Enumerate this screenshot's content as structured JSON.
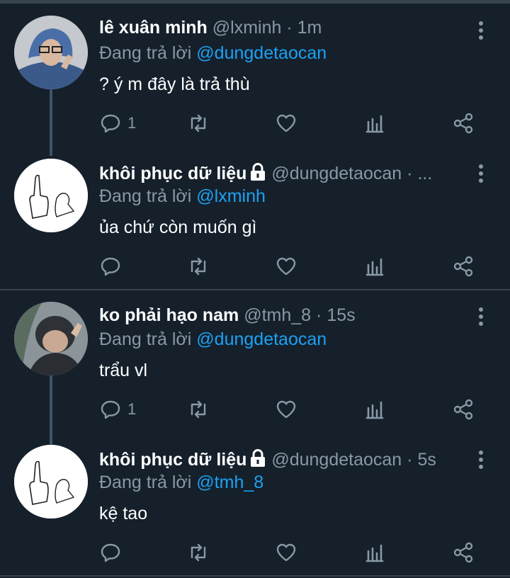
{
  "tweets": [
    {
      "name": "lê xuân minh",
      "locked": false,
      "handle": "@lxminh",
      "time": "· 1m",
      "reply_prefix": "Đang trả lời",
      "reply_to": "@dungdetaocan",
      "text": "? ý m đây là trả thù",
      "reply_count": "1"
    },
    {
      "name": "khôi phục dữ liệu",
      "locked": true,
      "handle": "@dungdetaocan",
      "time": "· ...",
      "reply_prefix": "Đang trả lời",
      "reply_to": "@lxminh",
      "text": "ủa chứ còn muốn gì",
      "reply_count": ""
    },
    {
      "name": "ko phải hạo nam",
      "locked": false,
      "handle": "@tmh_8",
      "time": "· 15s",
      "reply_prefix": "Đang trả lời",
      "reply_to": "@dungdetaocan",
      "text": "trẩu vl",
      "reply_count": "1"
    },
    {
      "name": "khôi phục dữ liệu",
      "locked": true,
      "handle": "@dungdetaocan",
      "time": "· 5s",
      "reply_prefix": "Đang trả lời",
      "reply_to": "@tmh_8",
      "text": "kệ tao",
      "reply_count": ""
    }
  ],
  "icons": {
    "reply": "reply-icon",
    "retweet": "retweet-icon",
    "like": "heart-icon",
    "analytics": "analytics-icon",
    "share": "share-icon",
    "more": "more-vertical-icon",
    "lock": "lock-icon"
  },
  "colors": {
    "background": "#15202b",
    "mention": "#1da1f2",
    "secondary_text": "#8899a6",
    "divider": "#38444d"
  }
}
